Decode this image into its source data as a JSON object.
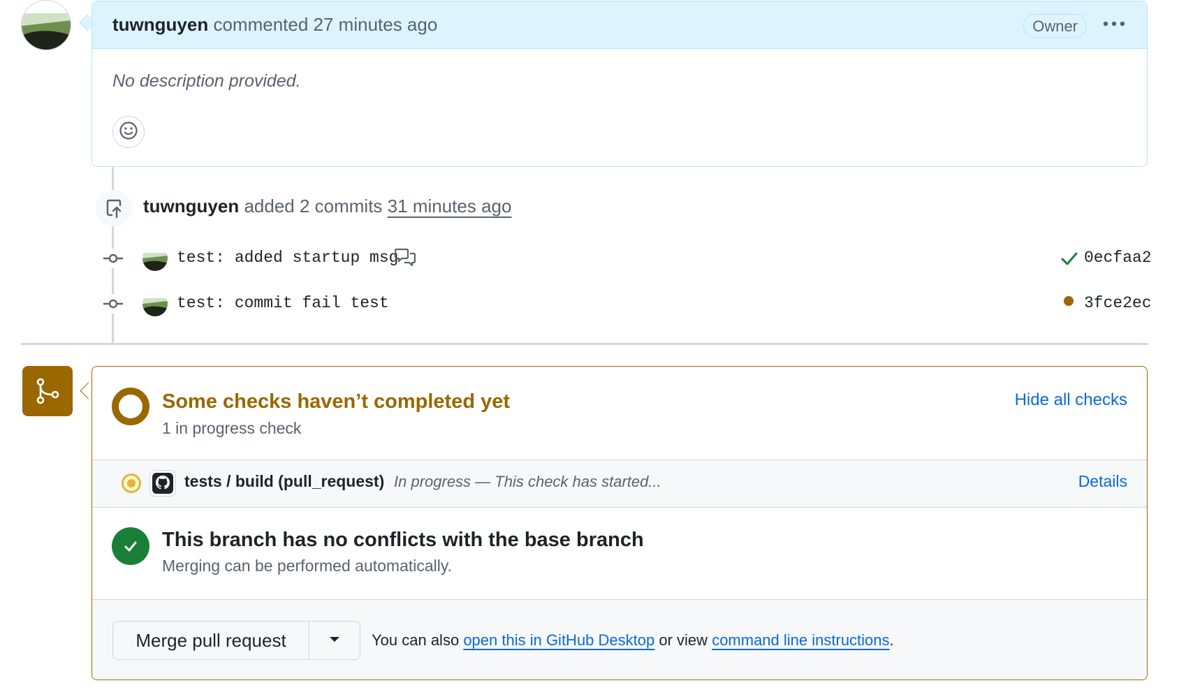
{
  "comment": {
    "author": "tuwnguyen",
    "action": "commented",
    "time": "27 minutes ago",
    "badge": "Owner",
    "menu_icon": "kebab-horizontal-icon",
    "description": "No description provided.",
    "reaction_icon": "smiley-icon"
  },
  "push_event": {
    "icon": "repo-push-icon",
    "author": "tuwnguyen",
    "action": "added 2 commits",
    "time": "31 minutes ago"
  },
  "commits": [
    {
      "message": "test: added startup msg",
      "has_comment_icon": true,
      "status": "success",
      "sha": "0ecfaa2"
    },
    {
      "message": "test: commit fail test",
      "has_comment_icon": false,
      "status": "pending",
      "sha": "3fce2ec"
    }
  ],
  "merge_box": {
    "icon": "git-merge-icon",
    "checks": {
      "title": "Some checks haven’t completed yet",
      "subtitle": "1 in progress check",
      "toggle_label": "Hide all checks",
      "items": [
        {
          "name": "tests / build (pull_request)",
          "status_text": "In progress — This check has started...",
          "details_label": "Details"
        }
      ]
    },
    "conflicts": {
      "title": "This branch has no conflicts with the base branch",
      "subtitle": "Merging can be performed automatically."
    },
    "actions": {
      "merge_label": "Merge pull request",
      "prefix": "You can also",
      "desktop_link": "open this in GitHub Desktop",
      "middle": "or view",
      "cli_link": "command line instructions",
      "suffix": "."
    }
  },
  "colors": {
    "accent_blue": "#0969da",
    "pending": "#9a6700",
    "success": "#1a7f37",
    "comment_header": "#ddf4ff"
  }
}
